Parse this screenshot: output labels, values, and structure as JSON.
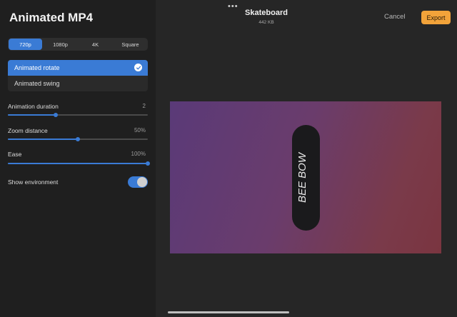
{
  "sidebar": {
    "title": "Animated MP4",
    "resolution_tabs": [
      {
        "label": "720p",
        "selected": true
      },
      {
        "label": "1080p",
        "selected": false
      },
      {
        "label": "4K",
        "selected": false
      },
      {
        "label": "Square",
        "selected": false
      }
    ],
    "animation_types": [
      {
        "label": "Animated rotate",
        "selected": true
      },
      {
        "label": "Animated swing",
        "selected": false
      }
    ],
    "sliders": [
      {
        "label": "Animation duration",
        "value": "2",
        "fraction": 0.34
      },
      {
        "label": "Zoom distance",
        "value": "50%",
        "fraction": 0.5
      },
      {
        "label": "Ease",
        "value": "100%",
        "fraction": 1.0
      }
    ],
    "show_environment": {
      "label": "Show environment",
      "on": true
    }
  },
  "topbar": {
    "more_icon": "more-dots-icon",
    "document_title": "Skateboard",
    "file_size": "442 KB",
    "cancel_label": "Cancel",
    "export_label": "Export"
  },
  "preview": {
    "board_text": "BEE BOW"
  },
  "colors": {
    "accent": "#3a7bd5",
    "export_button": "#f2a33a",
    "sidebar_bg": "#1f1f1f",
    "main_bg": "#262626"
  }
}
